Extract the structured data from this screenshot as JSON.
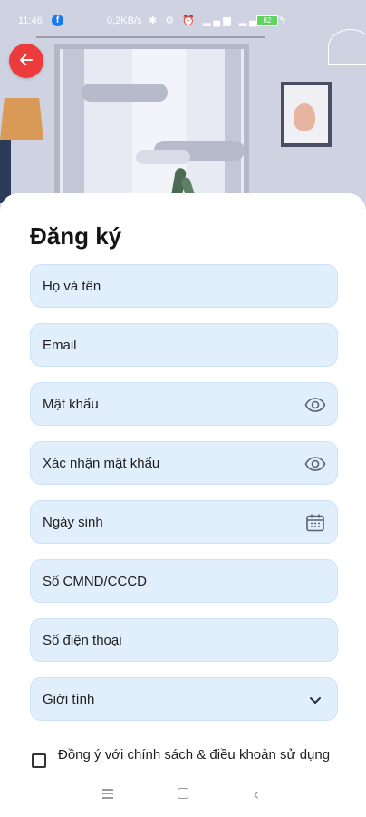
{
  "status_bar": {
    "time": "11:46",
    "facebook_badge": "f",
    "network_speed": "0,2KB/s",
    "battery_level": "82"
  },
  "hero": {
    "back_icon": "arrow-left-icon"
  },
  "form": {
    "title": "Đăng ký",
    "fields": {
      "full_name": "Họ và tên",
      "email": "Email",
      "password": "Mật khẩu",
      "confirm_password": "Xác nhận mật khẩu",
      "birthday": "Ngày sinh",
      "id_number": "Số CMND/CCCD",
      "phone": "Số điện thoại",
      "gender": "Giới tính"
    },
    "agree_text": "Đồng ý với chính sách & điều khoản sử dụng",
    "agree_checked": false
  },
  "colors": {
    "accent_red": "#ed3b3b",
    "field_bg": "#e1eefc",
    "field_border": "#cfe1f7"
  }
}
